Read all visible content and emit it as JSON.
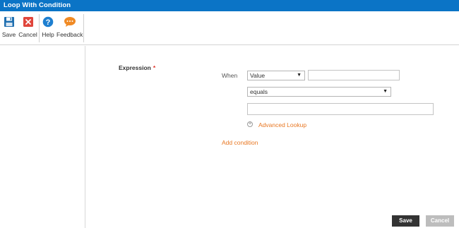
{
  "window": {
    "title": "Loop With Condition"
  },
  "toolbar": {
    "save_label": "Save",
    "cancel_label": "Cancel",
    "help_label": "Help",
    "feedback_label": "Feedback"
  },
  "form": {
    "expression_label": "Expression",
    "required_marker": "*",
    "when_label": "When",
    "lhs_type_select": "Value",
    "operator_select": "equals",
    "advanced_lookup_label": "Advanced Lookup",
    "add_condition_label": "Add condition"
  },
  "footer": {
    "save_label": "Save",
    "cancel_label": "Cancel"
  },
  "colors": {
    "titlebar": "#0b74c6",
    "link": "#e87722",
    "required": "#e0352b",
    "save_icon": "#1f6fb0",
    "cancel_icon": "#e0463c",
    "help_icon": "#1e7fd0",
    "feedback_icon": "#f08a24"
  }
}
